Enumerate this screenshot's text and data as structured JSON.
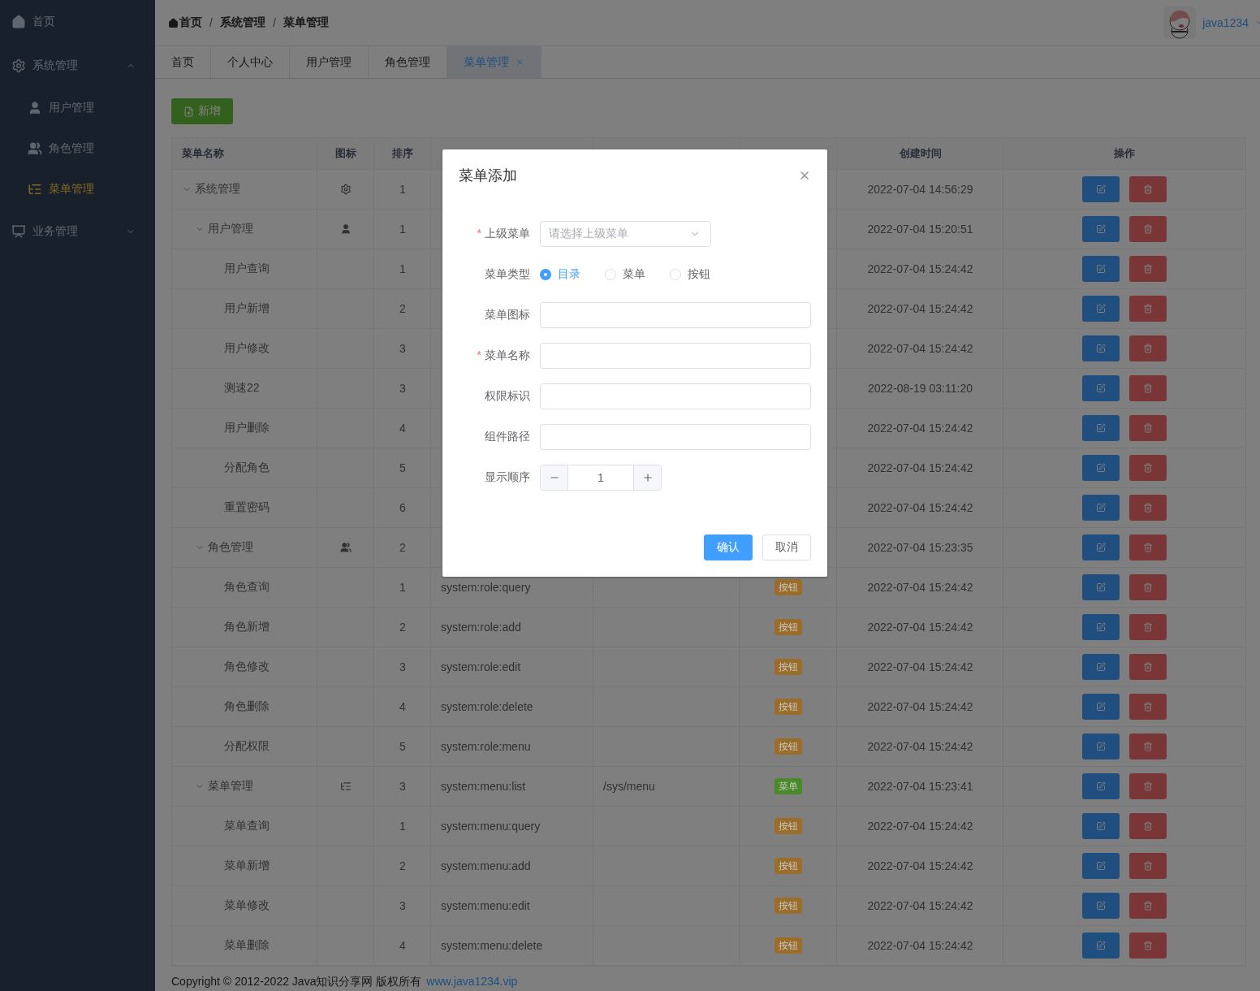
{
  "sidebar": {
    "items": [
      {
        "label": "首页",
        "kind": "home",
        "selected": false
      },
      {
        "label": "系统管理",
        "kind": "gear",
        "selected": false,
        "expanded": true,
        "children": [
          {
            "label": "用户管理",
            "kind": "user",
            "selected": false
          },
          {
            "label": "角色管理",
            "kind": "users",
            "selected": false
          },
          {
            "label": "菜单管理",
            "kind": "tree",
            "selected": true
          }
        ]
      },
      {
        "label": "业务管理",
        "kind": "monitor",
        "selected": false,
        "expanded": false
      }
    ]
  },
  "breadcrumb": {
    "separator": "/",
    "items": [
      "首页",
      "系统管理",
      "菜单管理"
    ]
  },
  "user": {
    "name": "java1234"
  },
  "tabs": [
    {
      "label": "首页",
      "selected": false,
      "closable": false
    },
    {
      "label": "个人中心",
      "selected": false,
      "closable": false
    },
    {
      "label": "用户管理",
      "selected": false,
      "closable": false
    },
    {
      "label": "角色管理",
      "selected": false,
      "closable": false
    },
    {
      "label": "菜单管理",
      "selected": true,
      "closable": true
    }
  ],
  "toolbar": {
    "add_button": "新增"
  },
  "table": {
    "columns": [
      "菜单名称",
      "图标",
      "排序",
      null,
      null,
      null,
      "创建时间",
      "操作"
    ],
    "rows": [
      {
        "name": "系统管理",
        "kind": "gear",
        "order": "1",
        "created": "2022-07-04 14:56:29",
        "expanded": true,
        "children": [
          {
            "name": "用户管理",
            "kind": "user",
            "order": "1",
            "created": "2022-07-04 15:20:51",
            "expanded": true,
            "children": [
              {
                "name": "用户查询",
                "order": "1",
                "created": "2022-07-04 15:24:42"
              },
              {
                "name": "用户新增",
                "order": "2",
                "created": "2022-07-04 15:24:42"
              },
              {
                "name": "用户修改",
                "order": "3",
                "created": "2022-07-04 15:24:42"
              },
              {
                "name": "测速22",
                "order": "3",
                "created": "2022-08-19 03:11:20"
              },
              {
                "name": "用户删除",
                "order": "4",
                "created": "2022-07-04 15:24:42"
              },
              {
                "name": "分配角色",
                "order": "5",
                "created": "2022-07-04 15:24:42"
              },
              {
                "name": "重置密码",
                "order": "6",
                "created": "2022-07-04 15:24:42"
              }
            ]
          },
          {
            "name": "角色管理",
            "kind": "users",
            "order": "2",
            "created": "2022-07-04 15:23:35",
            "expanded": true,
            "children": [
              {
                "name": "角色查询",
                "order": "1",
                "perms": "system:role:query",
                "type": {
                  "text": "按钮",
                  "color": "#9a6e2a"
                },
                "created": "2022-07-04 15:24:42"
              },
              {
                "name": "角色新增",
                "order": "2",
                "perms": "system:role:add",
                "type": {
                  "text": "按钮",
                  "color": "#9a6e2a"
                },
                "created": "2022-07-04 15:24:42"
              },
              {
                "name": "角色修改",
                "order": "3",
                "perms": "system:role:edit",
                "type": {
                  "text": "按钮",
                  "color": "#9a6e2a"
                },
                "created": "2022-07-04 15:24:42"
              },
              {
                "name": "角色删除",
                "order": "4",
                "perms": "system:role:delete",
                "type": {
                  "text": "按钮",
                  "color": "#9a6e2a"
                },
                "created": "2022-07-04 15:24:42"
              },
              {
                "name": "分配权限",
                "order": "5",
                "perms": "system:role:menu",
                "type": {
                  "text": "按钮",
                  "color": "#9a6e2a"
                },
                "created": "2022-07-04 15:24:42"
              }
            ]
          },
          {
            "name": "菜单管理",
            "kind": "tree",
            "order": "3",
            "perms": "system:menu:list",
            "path": "/sys/menu",
            "type": {
              "text": "菜单",
              "color": "#4a8a2a"
            },
            "created": "2022-07-04 15:23:41",
            "expanded": true,
            "children": [
              {
                "name": "菜单查询",
                "order": "1",
                "perms": "system:menu:query",
                "type": {
                  "text": "按钮",
                  "color": "#9a6e2a"
                },
                "created": "2022-07-04 15:24:42"
              },
              {
                "name": "菜单新增",
                "order": "2",
                "perms": "system:menu:add",
                "type": {
                  "text": "按钮",
                  "color": "#9a6e2a"
                },
                "created": "2022-07-04 15:24:42"
              },
              {
                "name": "菜单修改",
                "order": "3",
                "perms": "system:menu:edit",
                "type": {
                  "text": "按钮",
                  "color": "#9a6e2a"
                },
                "created": "2022-07-04 15:24:42"
              },
              {
                "name": "菜单删除",
                "order": "4",
                "perms": "system:menu:delete",
                "type": {
                  "text": "按钮",
                  "color": "#9a6e2a"
                },
                "created": "2022-07-04 15:24:42"
              }
            ]
          }
        ]
      }
    ]
  },
  "footer": {
    "text": "Copyright © 2012-2022 Java知识分享网 版权所有",
    "link": "www.java1234.vip"
  },
  "dialog": {
    "title": "菜单添加",
    "required_mark": "*",
    "fields": [
      {
        "kind": "select",
        "label": "上级菜单",
        "required": true,
        "placeholder": "请选择上级菜单"
      },
      {
        "kind": "radio",
        "label": "菜单类型",
        "required": false,
        "options": [
          {
            "label": "目录",
            "selected": true
          },
          {
            "label": "菜单",
            "selected": false
          },
          {
            "label": "按钮",
            "selected": false
          }
        ]
      },
      {
        "kind": "input",
        "label": "菜单图标",
        "required": false
      },
      {
        "kind": "input",
        "label": "菜单名称",
        "required": true
      },
      {
        "kind": "input",
        "label": "权限标识",
        "required": false
      },
      {
        "kind": "input",
        "label": "组件路径",
        "required": false
      },
      {
        "kind": "number",
        "label": "显示顺序",
        "required": false,
        "value": "1"
      }
    ],
    "buttons": [
      {
        "label": "确认",
        "primary": true
      },
      {
        "label": "取消",
        "primary": false
      }
    ]
  }
}
